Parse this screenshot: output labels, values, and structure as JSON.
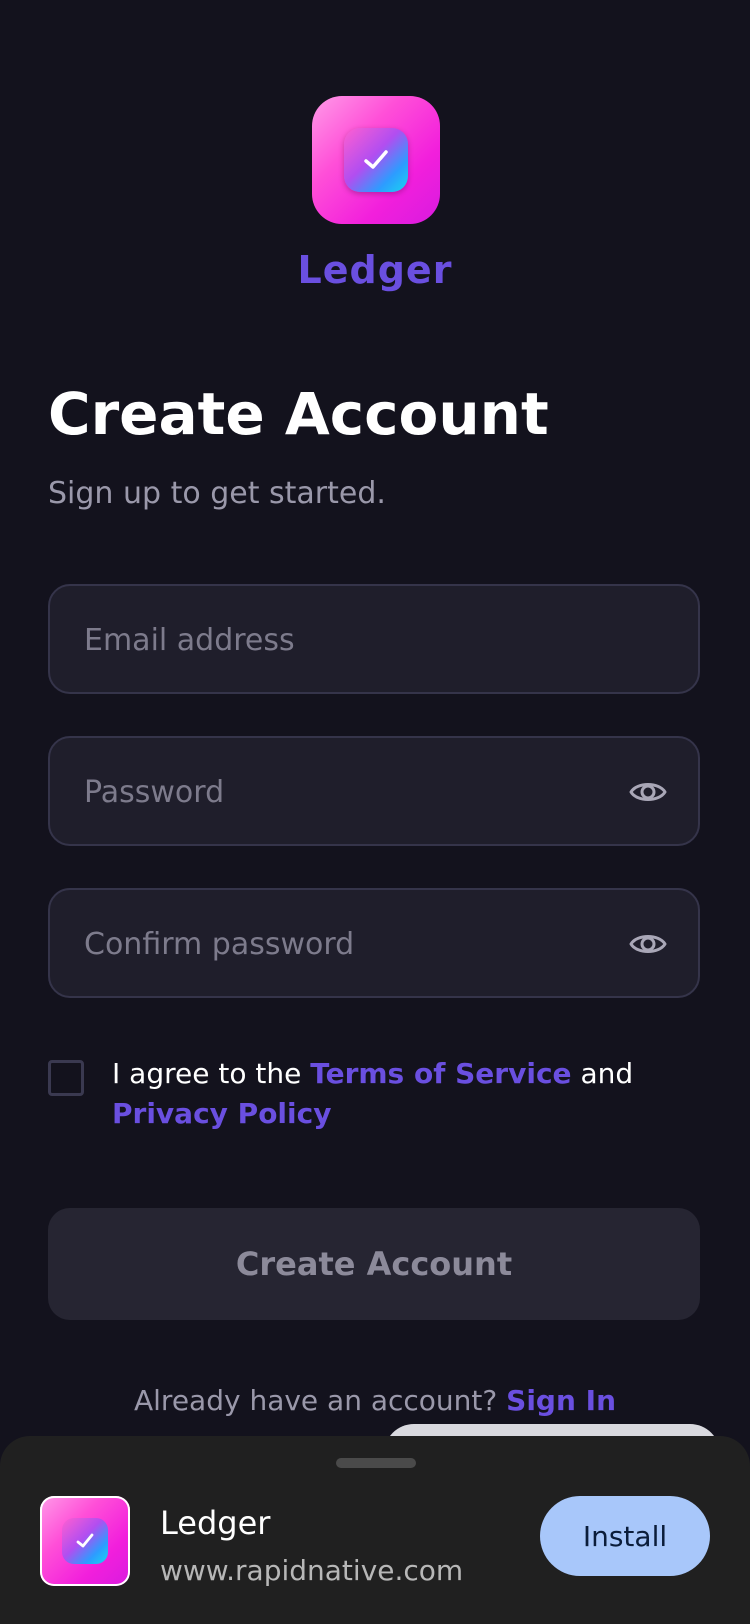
{
  "brand": {
    "name": "Ledger",
    "accent_color": "#6a4fe0",
    "logo_icon": "checkmark-icon"
  },
  "header": {
    "title": "Create Account",
    "subtitle": "Sign up to get started."
  },
  "form": {
    "email": {
      "value": "",
      "placeholder": "Email address"
    },
    "password": {
      "value": "",
      "placeholder": "Password",
      "toggle_icon": "eye-icon"
    },
    "confirm_password": {
      "value": "",
      "placeholder": "Confirm password",
      "toggle_icon": "eye-icon"
    },
    "agree": {
      "checked": false,
      "prefix": "I agree to the ",
      "terms_label": "Terms of Service",
      "middle": " and ",
      "privacy_label": "Privacy Policy"
    },
    "submit_label": "Create Account"
  },
  "footer": {
    "prompt": "Already have an account? ",
    "signin_label": "Sign In"
  },
  "install_sheet": {
    "app_name": "Ledger",
    "url": "www.rapidnative.com",
    "install_label": "Install",
    "button_color": "#a8c7fa"
  }
}
